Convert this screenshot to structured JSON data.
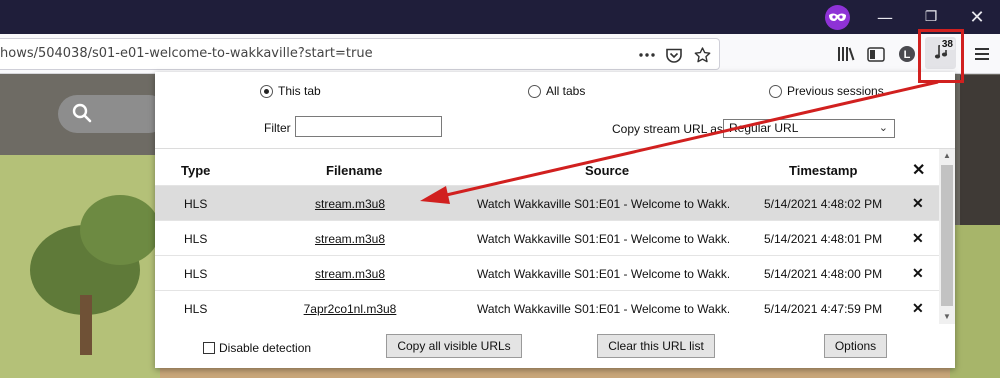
{
  "browser": {
    "url": "hows/504038/s01-e01-welcome-to-wakkaville?start=true",
    "extension_badge": "38",
    "icons": {
      "private": "private-mask-icon",
      "minimize": "minimize-icon",
      "restore": "restore-icon",
      "close": "close-icon",
      "page_actions": "more-dots-icon",
      "pocket": "pocket-icon",
      "bookmark": "star-icon",
      "library": "library-icon",
      "sidebar": "sidebar-icon",
      "account": "account-l-icon",
      "extension": "music-note-icon",
      "menu": "hamburger-menu-icon"
    }
  },
  "popup": {
    "radios": [
      {
        "label": "This tab",
        "checked": true
      },
      {
        "label": "All tabs",
        "checked": false
      },
      {
        "label": "Previous sessions",
        "checked": false
      }
    ],
    "filter_label": "Filter",
    "filter_value": "",
    "copy_as_label": "Copy stream URL as",
    "copy_as_value": "Regular URL",
    "columns": {
      "type": "Type",
      "filename": "Filename",
      "source": "Source",
      "timestamp": "Timestamp",
      "remove": "✕"
    },
    "rows": [
      {
        "type": "HLS",
        "filename": "stream.m3u8",
        "source": "Watch Wakkaville S01:E01 - Welcome to Wakk...",
        "timestamp": "5/14/2021 4:48:02 PM",
        "remove": "✕"
      },
      {
        "type": "HLS",
        "filename": "stream.m3u8",
        "source": "Watch Wakkaville S01:E01 - Welcome to Wakk...",
        "timestamp": "5/14/2021 4:48:01 PM",
        "remove": "✕"
      },
      {
        "type": "HLS",
        "filename": "stream.m3u8",
        "source": "Watch Wakkaville S01:E01 - Welcome to Wakk...",
        "timestamp": "5/14/2021 4:48:00 PM",
        "remove": "✕"
      },
      {
        "type": "HLS",
        "filename": "7apr2co1nl.m3u8",
        "source": "Watch Wakkaville S01:E01 - Welcome to Wakk...",
        "timestamp": "5/14/2021 4:47:59 PM",
        "remove": "✕"
      }
    ],
    "disable_detection_label": "Disable detection",
    "buttons": {
      "copy_all": "Copy all visible URLs",
      "clear": "Clear this URL list",
      "options": "Options"
    }
  },
  "colors": {
    "annotation_red": "#d1201f",
    "titlebar": "#1f1e3a",
    "private_purple": "#8e32d6"
  }
}
